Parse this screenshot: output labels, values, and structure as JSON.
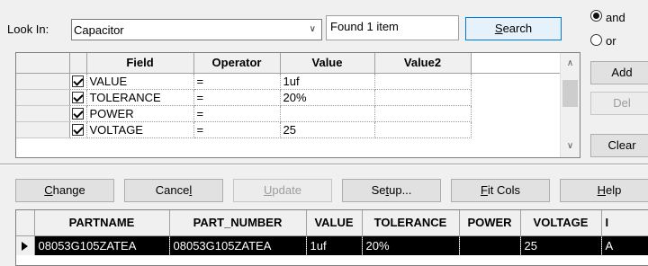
{
  "search_bar": {
    "look_in_label": "Look In:",
    "look_in_value": "Capacitor",
    "found_text": "Found 1 item",
    "search_button": "Search"
  },
  "logic": {
    "and_label": "and",
    "or_label": "or",
    "selected": "and"
  },
  "side_buttons": {
    "add": "Add",
    "del": "Del",
    "clear": "Clear"
  },
  "criteria": {
    "columns": [
      "Field",
      "Operator",
      "Value",
      "Value2"
    ],
    "rows": [
      {
        "checked": true,
        "field": "VALUE",
        "operator": "=",
        "value": "1uf",
        "value2": ""
      },
      {
        "checked": true,
        "field": "TOLERANCE",
        "operator": "=",
        "value": "20%",
        "value2": ""
      },
      {
        "checked": true,
        "field": "POWER",
        "operator": "=",
        "value": "",
        "value2": ""
      },
      {
        "checked": true,
        "field": "VOLTAGE",
        "operator": "=",
        "value": "25",
        "value2": ""
      }
    ]
  },
  "toolbar": {
    "change_pre": "",
    "change_key": "C",
    "change_post": "hange",
    "cancel_pre": "Cance",
    "cancel_key": "l",
    "cancel_post": "",
    "update_pre": "",
    "update_key": "U",
    "update_post": "pdate",
    "setup_pre": "Se",
    "setup_key": "t",
    "setup_post": "up...",
    "fitcols_pre": "",
    "fitcols_key": "F",
    "fitcols_post": "it Cols",
    "help_pre": "",
    "help_key": "H",
    "help_post": "elp"
  },
  "results": {
    "columns": [
      "PARTNAME",
      "PART_NUMBER",
      "VALUE",
      "TOLERANCE",
      "POWER",
      "VOLTAGE",
      "I"
    ],
    "rows": [
      {
        "partname": "08053G105ZATEA",
        "part_number": "08053G105ZATEA",
        "value": "1uf",
        "tolerance": "20%",
        "power": "",
        "voltage": "25",
        "extra": "A"
      }
    ]
  },
  "icons": {
    "dropdown": "chevron-down-icon",
    "scroll_up": "caret-up-icon",
    "scroll_down": "caret-down-icon",
    "row_pointer": "row-pointer-icon"
  },
  "colors": {
    "window_bg": "#f0f0f0",
    "accent": "#0078d7",
    "selection_bg": "#000000",
    "selection_fg": "#ffffff"
  }
}
